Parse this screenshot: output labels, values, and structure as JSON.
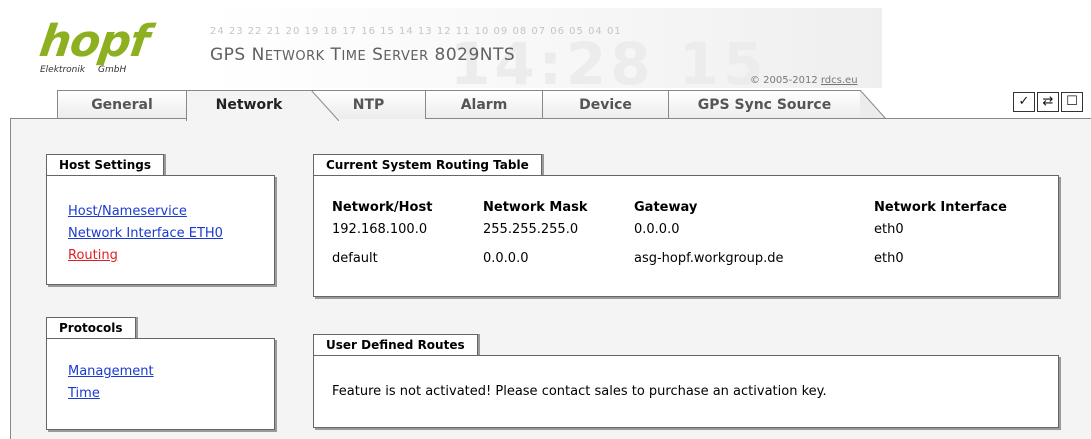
{
  "header": {
    "logo_text": "hopf",
    "logo_sub_left": "Elektronik",
    "logo_sub_right": "GmbH",
    "channel_numbers": "24 23 22 21 20 19 18 17 16 15 14 13 12 11 10 09 08 07 06 05 04 01",
    "product_title_first": "GPS N",
    "product_title_rest_1": "ETWORK",
    "product_title_mid_1": " T",
    "product_title_rest_2": "IME",
    "product_title_mid_2": " S",
    "product_title_rest_3": "ERVER",
    "product_title_model": " 8029NTS",
    "background_clock": "14:28 15",
    "copyright_text": "© 2005-2012 ",
    "copyright_link": "rdcs.eu"
  },
  "tabs": [
    {
      "label": "General",
      "active": false
    },
    {
      "label": "Network",
      "active": true
    },
    {
      "label": "NTP",
      "active": false
    },
    {
      "label": "Alarm",
      "active": false
    },
    {
      "label": "Device",
      "active": false
    },
    {
      "label": "GPS Sync Source",
      "active": false
    }
  ],
  "toolbar": {
    "apply_icon": "checkmark-icon",
    "apply_glyph": "✓",
    "reload_icon": "reload-icon",
    "reload_glyph": "⇄",
    "save_icon": "save-icon",
    "save_glyph": "☐"
  },
  "host_settings": {
    "title": "Host Settings",
    "links": [
      {
        "label": "Host/Nameservice",
        "active": false
      },
      {
        "label": "Network Interface ETH0",
        "active": false
      },
      {
        "label": "Routing",
        "active": true
      }
    ]
  },
  "protocols": {
    "title": "Protocols",
    "links": [
      {
        "label": "Management",
        "active": false
      },
      {
        "label": "Time",
        "active": false
      }
    ]
  },
  "routing_table": {
    "title": "Current System Routing Table",
    "columns": [
      "Network/Host",
      "Network Mask",
      "Gateway",
      "Network Interface"
    ],
    "rows": [
      [
        "192.168.100.0",
        "255.255.255.0",
        "0.0.0.0",
        "eth0"
      ],
      [
        "default",
        "0.0.0.0",
        "asg-hopf.workgroup.de",
        "eth0"
      ]
    ]
  },
  "user_routes": {
    "title": "User Defined Routes",
    "message": "Feature is not activated! Please contact sales to purchase an activation key."
  },
  "colors": {
    "logo_green": "#8db020",
    "link_blue": "#1a3ad0",
    "link_active_red": "#e02020",
    "panel_bg": "#f4f4f4"
  }
}
